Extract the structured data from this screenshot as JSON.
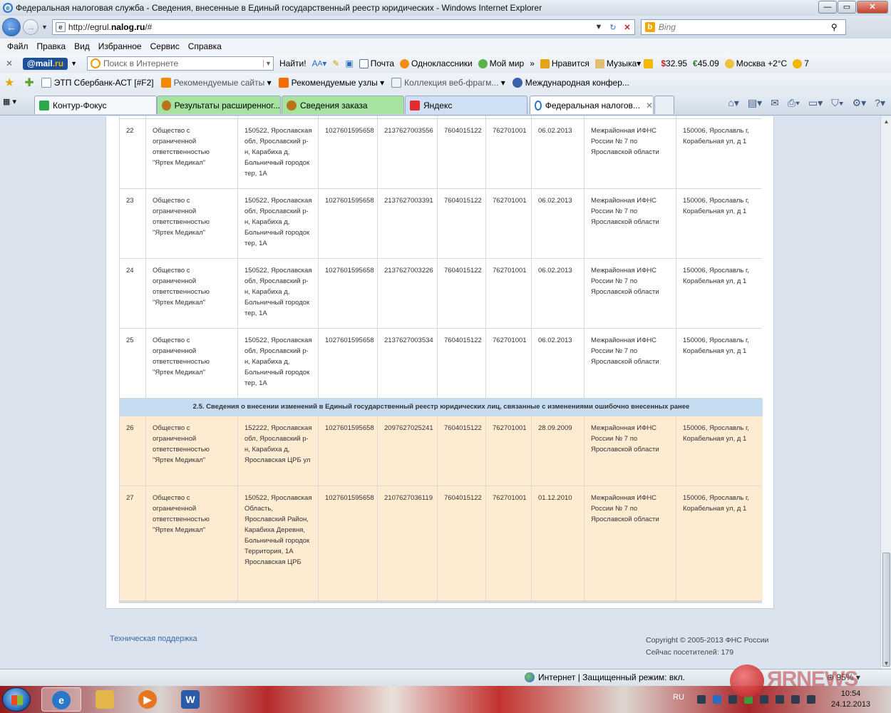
{
  "window": {
    "title": "Федеральная налоговая служба - Сведения, внесенные в Единый государственный реестр юридических - Windows Internet Explorer"
  },
  "address": {
    "url_prefix": "http://egrul.",
    "url_domain": "nalog.ru",
    "url_suffix": "/#",
    "search_placeholder": "Bing"
  },
  "menu": [
    "Файл",
    "Правка",
    "Вид",
    "Избранное",
    "Сервис",
    "Справка"
  ],
  "mailbar": {
    "logo_a": "@mail",
    "logo_b": ".ru",
    "search_placeholder": "Поиск в Интернете",
    "find": "Найти!",
    "mail": "Почта",
    "ok": "Одноклассники",
    "myworld": "Мой мир",
    "likes": "Нравится",
    "music": "Музыка",
    "usd": "32.95",
    "eur": "45.09",
    "weather": "Москва +2°C",
    "count": "7"
  },
  "favorites": [
    "ЭТП Сбербанк-АСТ [#F2]",
    "Рекомендуемые сайты",
    "Рекомендуемые узлы",
    "Коллекция веб-фрагм...",
    "Международная конфер..."
  ],
  "tabs": [
    {
      "label": "Контур-Фокус",
      "color": "#f4f7fb",
      "icon": "#2aa84a"
    },
    {
      "label": "Результаты расширенног...",
      "color": "#a6e3a0",
      "icon": "#b8741a"
    },
    {
      "label": "Сведения заказа",
      "color": "#a6e3a0",
      "icon": "#b8741a"
    },
    {
      "label": "Яндекс",
      "color": "#cfe0f5",
      "icon": "#e32b2b"
    },
    {
      "label": "Федеральная налогов...",
      "color": "#ffffff",
      "icon": "#2a77c9"
    }
  ],
  "section_title": "2.5. Сведения о внесении изменений в Единый государственный реестр юридических лиц, связанные с изменениями ошибочно внесенных ранее",
  "rows_white": [
    [
      "22",
      "Общество с ограниченной ответственностью \"Яртек Медикал\"",
      "150522, Ярославская обл, Ярославский р-н, Карабиха д, Больничный городок тер, 1А",
      "1027601595658",
      "2137627003556",
      "7604015122",
      "762701001",
      "06.02.2013",
      "Межрайонная ИФНС России № 7 по Ярославской области",
      "150006, Ярославль г, Корабельная ул, д 1"
    ],
    [
      "23",
      "Общество с ограниченной ответственностью \"Яртек Медикал\"",
      "150522, Ярославская обл, Ярославский р-н, Карабиха д, Больничный городок тер, 1А",
      "1027601595658",
      "2137627003391",
      "7604015122",
      "762701001",
      "06.02.2013",
      "Межрайонная ИФНС России № 7 по Ярославской области",
      "150006, Ярославль г, Корабельная ул, д 1"
    ],
    [
      "24",
      "Общество с ограниченной ответственностью \"Яртек Медикал\"",
      "150522, Ярославская обл, Ярославский р-н, Карабиха д, Больничный городок тер, 1А",
      "1027601595658",
      "2137627003226",
      "7604015122",
      "762701001",
      "06.02.2013",
      "Межрайонная ИФНС России № 7 по Ярославской области",
      "150006, Ярославль г, Корабельная ул, д 1"
    ],
    [
      "25",
      "Общество с ограниченной ответственностью \"Яртек Медикал\"",
      "150522, Ярославская обл, Ярославский р-н, Карабиха д, Больничный городок тер, 1А",
      "1027601595658",
      "2137627003534",
      "7604015122",
      "762701001",
      "06.02.2013",
      "Межрайонная ИФНС России № 7 по Ярославской области",
      "150006, Ярославль г, Корабельная ул, д 1"
    ]
  ],
  "rows_orange": [
    [
      "26",
      "Общество с ограниченной ответственностью \"Яртек Медикал\"",
      "152222, Ярославская обл, Ярославский р-н, Карабиха д, Ярославская ЦРБ ул",
      "1027601595658",
      "2097627025241",
      "7604015122",
      "762701001",
      "28.09.2009",
      "Межрайонная ИФНС России № 7 по Ярославской области",
      "150006, Ярославль г, Корабельная ул, д 1"
    ],
    [
      "27",
      "Общество с ограниченной ответственностью \"Яртек Медикал\"",
      "150522, Ярославская Область, Ярославский Район, Карабиха Деревня, Больничный городок Территория, 1А Ярославская ЦРБ",
      "1027601595658",
      "2107627036119",
      "7604015122",
      "762701001",
      "01.12.2010",
      "Межрайонная ИФНС России № 7 по Ярославской области",
      "150006, Ярославль г, Корабельная ул, д 1"
    ]
  ],
  "footer": {
    "support": "Техническая поддержка",
    "copyright": "Copyright © 2005-2013 ФНС России",
    "visitors": "Сейчас посетителей: 179"
  },
  "status": {
    "zone": "Интернет | Защищенный режим: вкл.",
    "zoom": "95%"
  },
  "taskbar": {
    "lang": "RU",
    "time": "10:54",
    "date": "24.12.2013"
  },
  "watermark": "ЯRNEWS"
}
